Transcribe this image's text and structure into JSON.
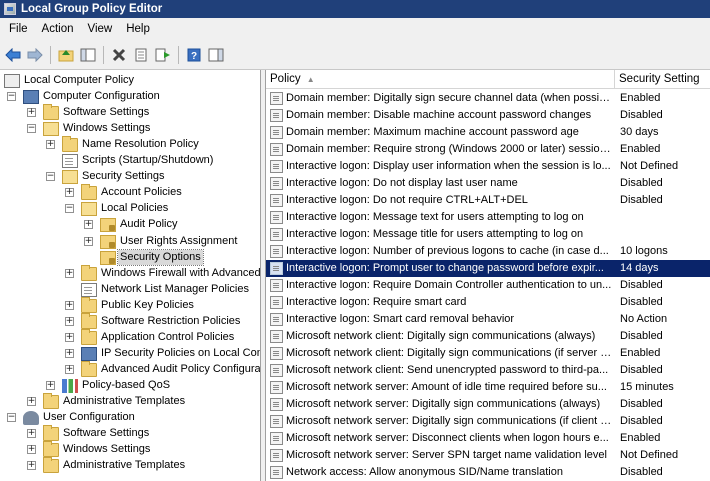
{
  "window": {
    "title": "Local Group Policy Editor"
  },
  "menu": [
    "File",
    "Action",
    "View",
    "Help"
  ],
  "toolbar": {
    "icons": [
      "back-arrow-icon",
      "forward-arrow-icon",
      "up-folder-icon",
      "show-hide-tree-icon",
      "delete-icon",
      "properties-icon",
      "export-list-icon",
      "help-icon",
      "show-hide-action-pane-icon"
    ]
  },
  "tree": [
    {
      "label": "Local Computer Policy",
      "level": 0,
      "icon": "pc",
      "expander": ""
    },
    {
      "label": "Computer Configuration",
      "level": 1,
      "icon": "computer",
      "expander": "−"
    },
    {
      "label": "Software Settings",
      "level": 2,
      "icon": "folder",
      "expander": "+"
    },
    {
      "label": "Windows Settings",
      "level": 2,
      "icon": "folder-open",
      "expander": "−"
    },
    {
      "label": "Name Resolution Policy",
      "level": 3,
      "icon": "folder",
      "expander": "+"
    },
    {
      "label": "Scripts (Startup/Shutdown)",
      "level": 3,
      "icon": "doc",
      "expander": ""
    },
    {
      "label": "Security Settings",
      "level": 3,
      "icon": "folder-open",
      "expander": "−"
    },
    {
      "label": "Account Policies",
      "level": 4,
      "icon": "folder",
      "expander": "+"
    },
    {
      "label": "Local Policies",
      "level": 4,
      "icon": "folder-open",
      "expander": "−"
    },
    {
      "label": "Audit Policy",
      "level": 5,
      "icon": "lock-folder",
      "expander": "+"
    },
    {
      "label": "User Rights Assignment",
      "level": 5,
      "icon": "lock-folder",
      "expander": "+"
    },
    {
      "label": "Security Options",
      "level": 5,
      "icon": "lock-folder",
      "expander": "",
      "selected": true
    },
    {
      "label": "Windows Firewall with Advanced",
      "level": 4,
      "icon": "folder",
      "expander": "+"
    },
    {
      "label": "Network List Manager Policies",
      "level": 4,
      "icon": "doc",
      "expander": ""
    },
    {
      "label": "Public Key Policies",
      "level": 4,
      "icon": "folder",
      "expander": "+"
    },
    {
      "label": "Software Restriction Policies",
      "level": 4,
      "icon": "folder",
      "expander": "+"
    },
    {
      "label": "Application Control Policies",
      "level": 4,
      "icon": "folder",
      "expander": "+"
    },
    {
      "label": "IP Security Policies on Local Comp",
      "level": 4,
      "icon": "computer",
      "expander": "+"
    },
    {
      "label": "Advanced Audit Policy Configura",
      "level": 4,
      "icon": "folder",
      "expander": "+"
    },
    {
      "label": "Policy-based QoS",
      "level": 3,
      "icon": "chart",
      "expander": "+"
    },
    {
      "label": "Administrative Templates",
      "level": 2,
      "icon": "folder",
      "expander": "+"
    },
    {
      "label": "User Configuration",
      "level": 1,
      "icon": "user",
      "expander": "−"
    },
    {
      "label": "Software Settings",
      "level": 2,
      "icon": "folder",
      "expander": "+"
    },
    {
      "label": "Windows Settings",
      "level": 2,
      "icon": "folder",
      "expander": "+"
    },
    {
      "label": "Administrative Templates",
      "level": 2,
      "icon": "folder",
      "expander": "+"
    }
  ],
  "list": {
    "columns": {
      "policy": "Policy",
      "setting": "Security Setting"
    },
    "rows": [
      {
        "policy": "Domain member: Digitally sign secure channel data (when possible)",
        "setting": "Enabled"
      },
      {
        "policy": "Domain member: Disable machine account password changes",
        "setting": "Disabled"
      },
      {
        "policy": "Domain member: Maximum machine account password age",
        "setting": "30 days"
      },
      {
        "policy": "Domain member: Require strong (Windows 2000 or later) session ...",
        "setting": "Enabled"
      },
      {
        "policy": "Interactive logon: Display user information when the session is lo...",
        "setting": "Not Defined"
      },
      {
        "policy": "Interactive logon: Do not display last user name",
        "setting": "Disabled"
      },
      {
        "policy": "Interactive logon: Do not require CTRL+ALT+DEL",
        "setting": "Disabled"
      },
      {
        "policy": "Interactive logon: Message text for users attempting to log on",
        "setting": ""
      },
      {
        "policy": "Interactive logon: Message title for users attempting to log on",
        "setting": ""
      },
      {
        "policy": "Interactive logon: Number of previous logons to cache (in case d...",
        "setting": "10 logons"
      },
      {
        "policy": "Interactive logon: Prompt user to change password before expir...",
        "setting": "14 days",
        "selected": true
      },
      {
        "policy": "Interactive logon: Require Domain Controller authentication to un...",
        "setting": "Disabled"
      },
      {
        "policy": "Interactive logon: Require smart card",
        "setting": "Disabled"
      },
      {
        "policy": "Interactive logon: Smart card removal behavior",
        "setting": "No Action"
      },
      {
        "policy": "Microsoft network client: Digitally sign communications (always)",
        "setting": "Disabled"
      },
      {
        "policy": "Microsoft network client: Digitally sign communications (if server a...",
        "setting": "Enabled"
      },
      {
        "policy": "Microsoft network client: Send unencrypted password to third-pa...",
        "setting": "Disabled"
      },
      {
        "policy": "Microsoft network server: Amount of idle time required before su...",
        "setting": "15 minutes"
      },
      {
        "policy": "Microsoft network server: Digitally sign communications (always)",
        "setting": "Disabled"
      },
      {
        "policy": "Microsoft network server: Digitally sign communications (if client a...",
        "setting": "Disabled"
      },
      {
        "policy": "Microsoft network server: Disconnect clients when logon hours e...",
        "setting": "Enabled"
      },
      {
        "policy": "Microsoft network server: Server SPN target name validation level",
        "setting": "Not Defined"
      },
      {
        "policy": "Network access: Allow anonymous SID/Name translation",
        "setting": "Disabled"
      }
    ]
  }
}
